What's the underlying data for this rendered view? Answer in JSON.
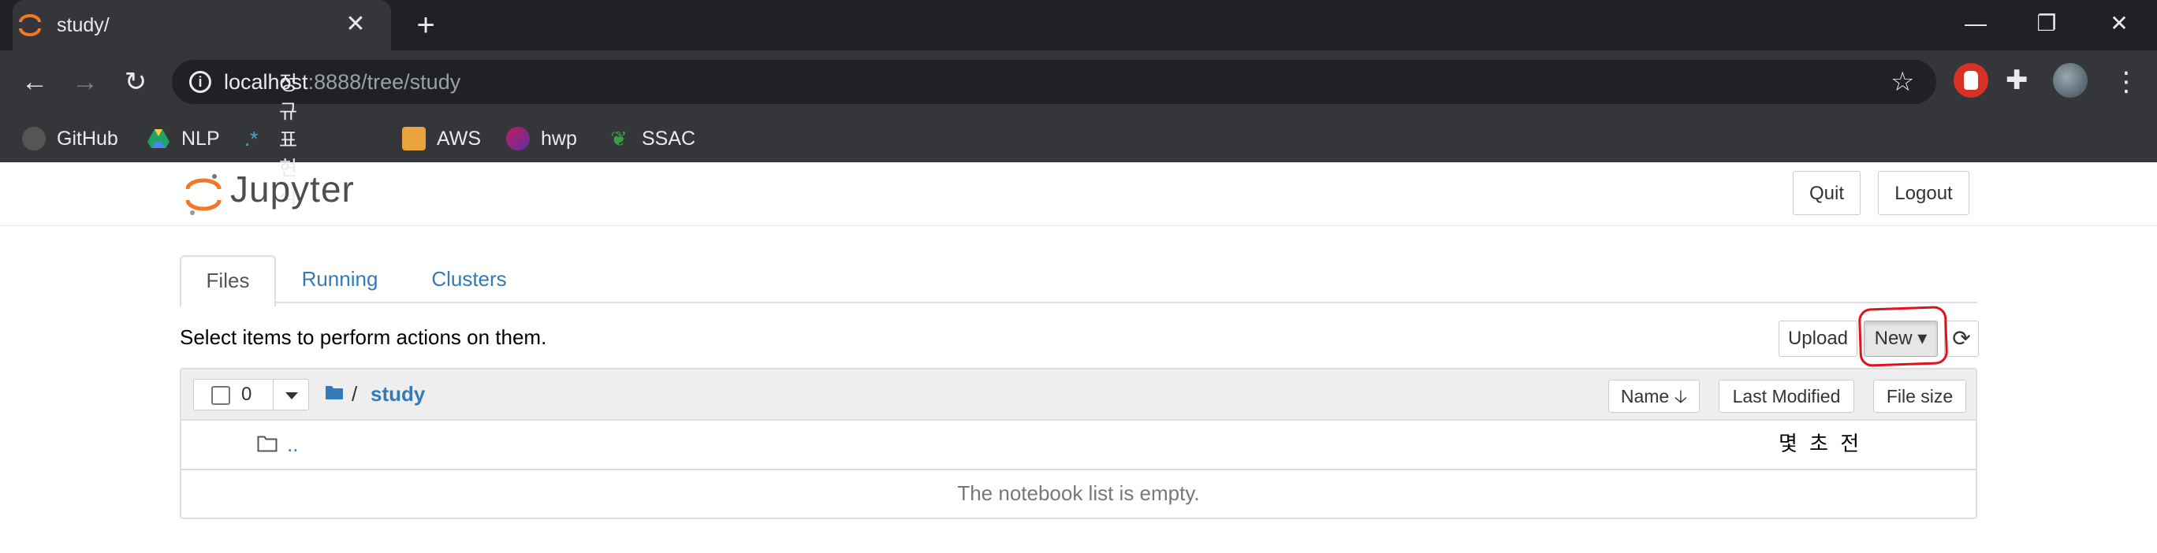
{
  "browser": {
    "tab_title": "study/",
    "tab_close": "✕",
    "new_tab": "+",
    "url_host": "localhost",
    "url_path": ":8888/tree/study",
    "window_controls": {
      "minimize": "—",
      "restore": "❐",
      "close": "✕"
    },
    "bookmarks": [
      {
        "label": "GitHub",
        "icon": "github-icon",
        "color": "#444"
      },
      {
        "label": "NLP",
        "icon": "google-drive-icon",
        "color": "#1fa463"
      },
      {
        "label": "정규표현식",
        "icon": "regex-icon",
        "color": "#4ea1d3"
      },
      {
        "label": "AWS",
        "icon": "aws-box-icon",
        "color": "#e8a33d"
      },
      {
        "label": "hwp",
        "icon": "hwp-icon",
        "color": "#7b3fa8"
      },
      {
        "label": "SSAC",
        "icon": "ssac-icon",
        "color": "#3a9e44"
      }
    ]
  },
  "jupyter": {
    "logo_text": "Jupyter",
    "quit_label": "Quit",
    "logout_label": "Logout",
    "tabs": [
      {
        "label": "Files"
      },
      {
        "label": "Running"
      },
      {
        "label": "Clusters"
      }
    ],
    "select_message": "Select items to perform actions on them.",
    "upload_label": "Upload",
    "new_label": "New ▾",
    "refresh_icon": "refresh-icon",
    "selected_count": "0",
    "breadcrumb": {
      "root": "/",
      "current": "study"
    },
    "sort": {
      "name_label": "Name 🡣",
      "modified_label": "Last Modified",
      "size_label": "File size"
    },
    "rows": [
      {
        "name": "..",
        "modified": "몇 초 전"
      }
    ],
    "empty_message": "The notebook list is empty."
  },
  "colors": {
    "accent": "#337ab7",
    "highlight": "#e0121b",
    "logo_orange": "#f37726"
  }
}
